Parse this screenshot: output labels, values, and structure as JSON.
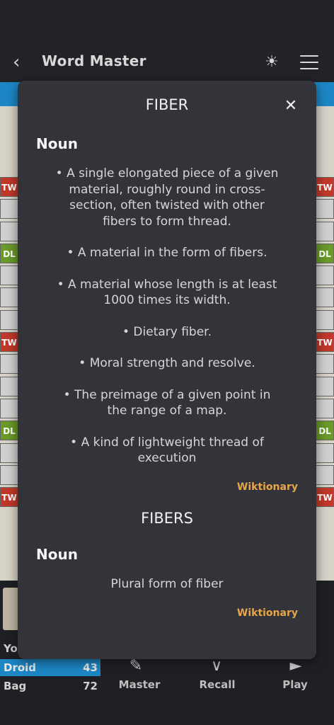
{
  "header": {
    "title": "Word Master",
    "back_icon": "chevron-left-icon",
    "theme_icon": "sun-icon",
    "menu_icon": "menu-icon"
  },
  "board": {
    "left_cells": [
      "TW",
      "",
      "",
      "DL",
      "",
      "",
      "",
      "TW",
      "",
      "",
      "",
      "DL",
      "",
      "",
      "TW"
    ],
    "right_cells": [
      "TW",
      "",
      "",
      "DL",
      "",
      "",
      "",
      "TW",
      "",
      "",
      "",
      "DL",
      "",
      "",
      "TW"
    ]
  },
  "bottom": {
    "you_label": "Yo",
    "droid_label": "Droid",
    "droid_score": "43",
    "bag_label": "Bag",
    "bag_count": "72",
    "nav": [
      "Master",
      "Recall",
      "Play"
    ]
  },
  "modal": {
    "title": "FIBER",
    "close_icon": "close-icon",
    "pos1": "Noun",
    "definitions": [
      "• A single elongated piece of a given material, roughly round in cross-section, often twisted with other fibers to form thread.",
      "• A material in the form of fibers.",
      "• A material whose length is at least 1000 times its width.",
      "• Dietary fiber.",
      "• Moral strength and resolve.",
      "• The preimage of a given point in the range of a map.",
      "• A kind of lightweight thread of execution"
    ],
    "source1": "Wiktionary",
    "title2": "FIBERS",
    "pos2": "Noun",
    "plural_def": "Plural form of fiber",
    "source2": "Wiktionary"
  },
  "colors": {
    "accent": "#1d87c6",
    "source_link": "#e8a64a",
    "modal_bg": "#323439"
  }
}
